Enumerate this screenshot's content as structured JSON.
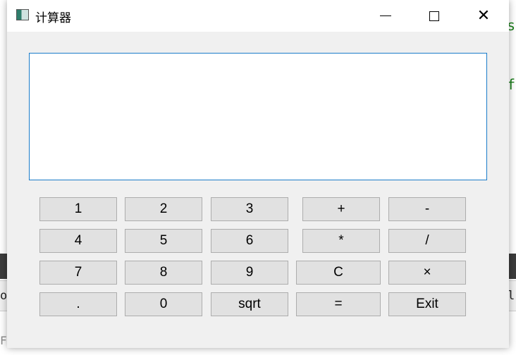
{
  "window": {
    "title": "计算器",
    "controls": {
      "minimize": "—",
      "maximize": "☐",
      "close": "✕"
    }
  },
  "display": {
    "value": ""
  },
  "buttons": {
    "row1": [
      "1",
      "2",
      "3",
      "+",
      "-"
    ],
    "row2": [
      "4",
      "5",
      "6",
      "*",
      "/"
    ],
    "row3": [
      "7",
      "8",
      "9",
      "C",
      "×"
    ],
    "row4": [
      ".",
      "0",
      "sqrt",
      "=",
      "Exit"
    ]
  },
  "background": {
    "right_chars": [
      "s",
      "f"
    ],
    "edge_left": "o",
    "edge_right": "l",
    "bottom_text": "F"
  },
  "colors": {
    "accent": "#1a7cc9",
    "button_face": "#e1e1e1",
    "window_bg": "#f0f0f0"
  }
}
